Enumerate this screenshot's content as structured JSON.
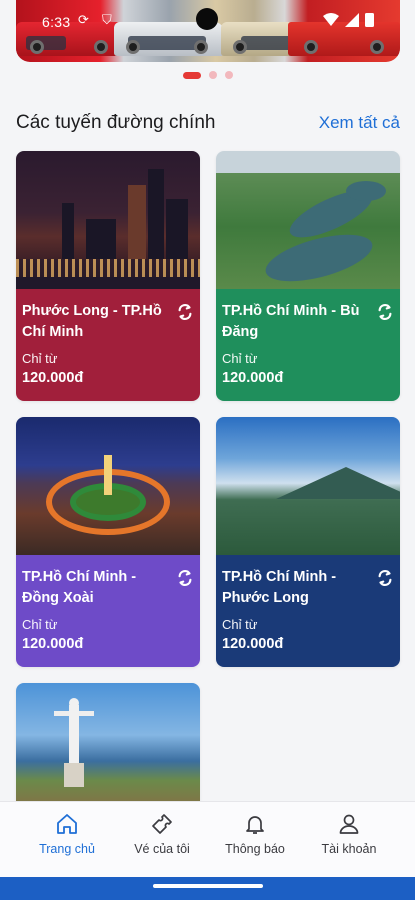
{
  "status_bar": {
    "time": "6:33"
  },
  "carousel": {
    "slide_count": 3,
    "active_index": 0
  },
  "section": {
    "title": "Các tuyến đường chính",
    "see_all": "Xem tất cả"
  },
  "routes": [
    {
      "name": "Phước Long - TP.Hồ Chí Minh",
      "from_label": "Chỉ từ",
      "price": "120.000đ",
      "color": "#a11f3b",
      "icon": "swap-icon"
    },
    {
      "name": "TP.Hồ Chí Minh - Bù Đăng",
      "from_label": "Chỉ từ",
      "price": "120.000đ",
      "color": "#1f8f5c",
      "icon": "swap-icon"
    },
    {
      "name": "TP.Hồ Chí Minh - Đồng Xoài",
      "from_label": "Chỉ từ",
      "price": "120.000đ",
      "color": "#6e4bc8",
      "icon": "swap-icon"
    },
    {
      "name": "TP.Hồ Chí Minh - Phước Long",
      "from_label": "Chỉ từ",
      "price": "120.000đ",
      "color": "#1a3a78",
      "icon": "swap-icon"
    }
  ],
  "nav": {
    "items": [
      {
        "label": "Trang chủ",
        "icon": "home-icon",
        "active": true
      },
      {
        "label": "Vé của tôi",
        "icon": "ticket-icon",
        "active": false
      },
      {
        "label": "Thông báo",
        "icon": "bell-icon",
        "active": false
      },
      {
        "label": "Tài khoản",
        "icon": "user-icon",
        "active": false
      }
    ]
  },
  "colors": {
    "accent": "#1f6fd6",
    "brand_red": "#e53935"
  }
}
